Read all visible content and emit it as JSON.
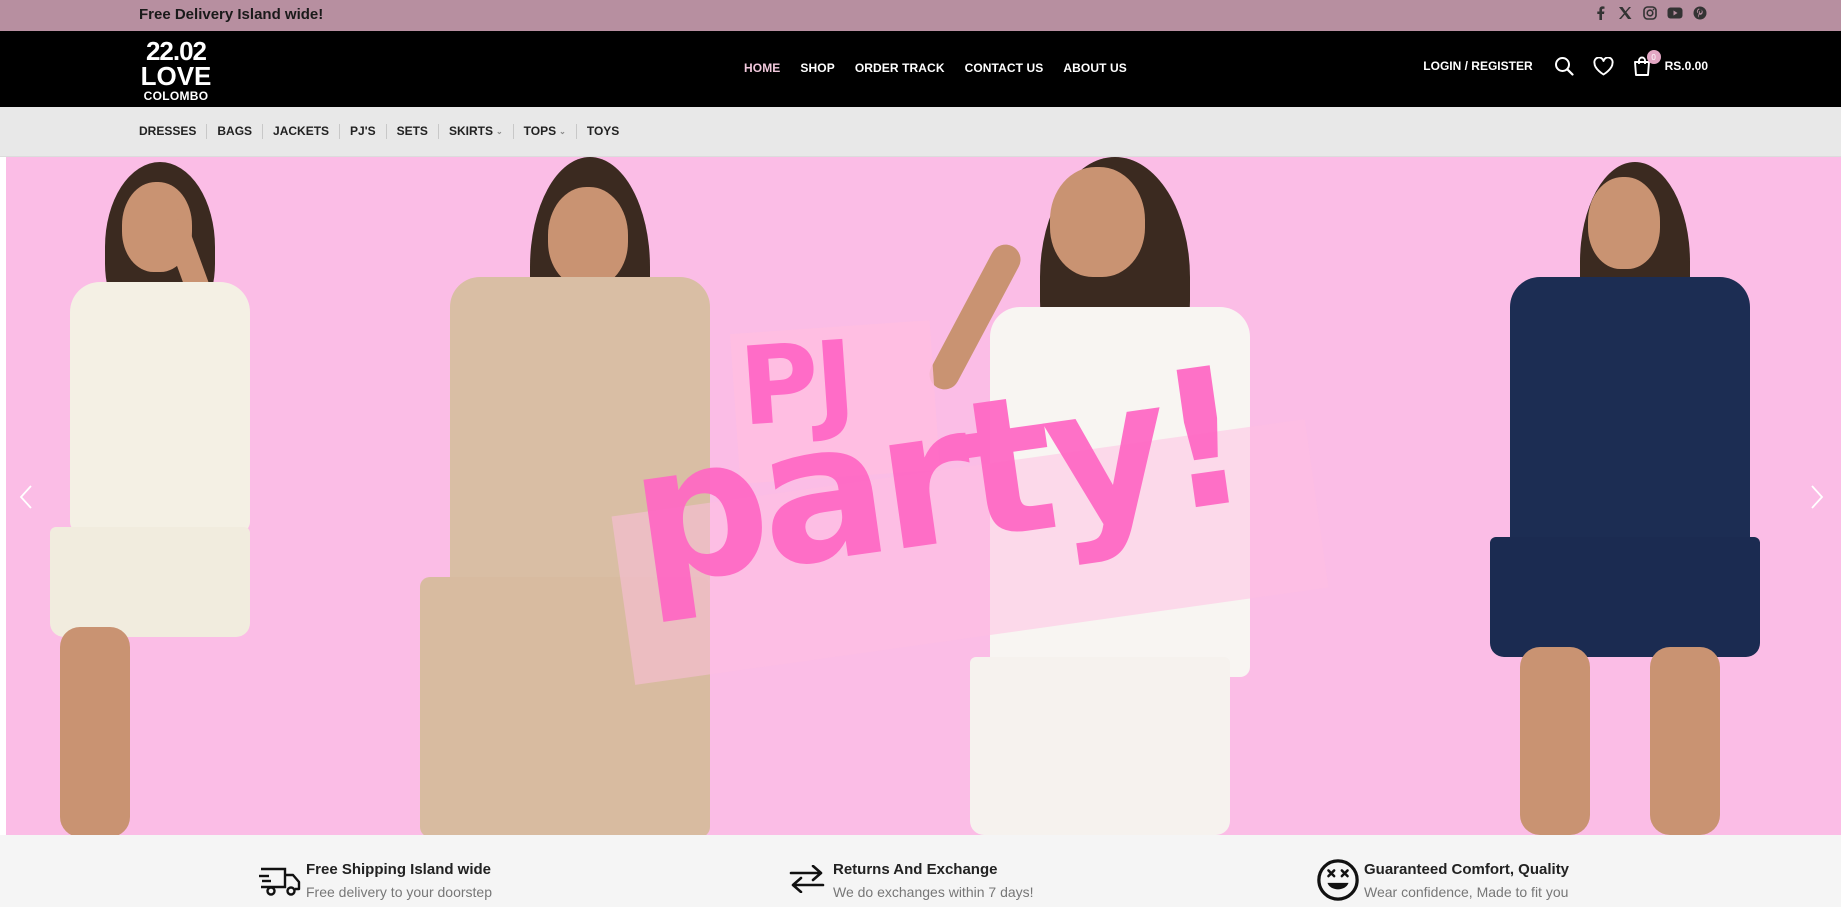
{
  "topbar": {
    "promo": "Free Delivery Island wide!",
    "socials": [
      "facebook-icon",
      "x-icon",
      "instagram-icon",
      "youtube-icon",
      "pinterest-icon"
    ]
  },
  "logo": {
    "line1": "22.02",
    "line2": "LOVE",
    "line3": "COLOMBO"
  },
  "nav": {
    "items": [
      {
        "label": "HOME",
        "active": true
      },
      {
        "label": "SHOP"
      },
      {
        "label": "ORDER TRACK"
      },
      {
        "label": "CONTACT US"
      },
      {
        "label": "ABOUT US"
      }
    ]
  },
  "header_right": {
    "login_label": "LOGIN / REGISTER",
    "cart_count": "0",
    "cart_total": "RS.0.00"
  },
  "categories": [
    {
      "label": "DRESSES"
    },
    {
      "label": "BAGS"
    },
    {
      "label": "JACKETS"
    },
    {
      "label": "PJ'S"
    },
    {
      "label": "SETS"
    },
    {
      "label": "SKIRTS",
      "dropdown": true
    },
    {
      "label": "TOPS",
      "dropdown": true
    },
    {
      "label": "TOYS"
    }
  ],
  "hero": {
    "headline_1": "PJ",
    "headline_2": "party!",
    "bg_color": "#fbbde6",
    "accent_color": "#ff68c4"
  },
  "features": [
    {
      "icon": "delivery-truck-icon",
      "title": "Free Shipping Island wide",
      "desc": "Free delivery to your doorstep"
    },
    {
      "icon": "exchange-arrows-icon",
      "title": "Returns And Exchange",
      "desc": "We do exchanges within 7 days!"
    },
    {
      "icon": "smiley-face-icon",
      "title": "Guaranteed Comfort, Quality",
      "desc": "Wear confidence, Made to fit you"
    }
  ]
}
